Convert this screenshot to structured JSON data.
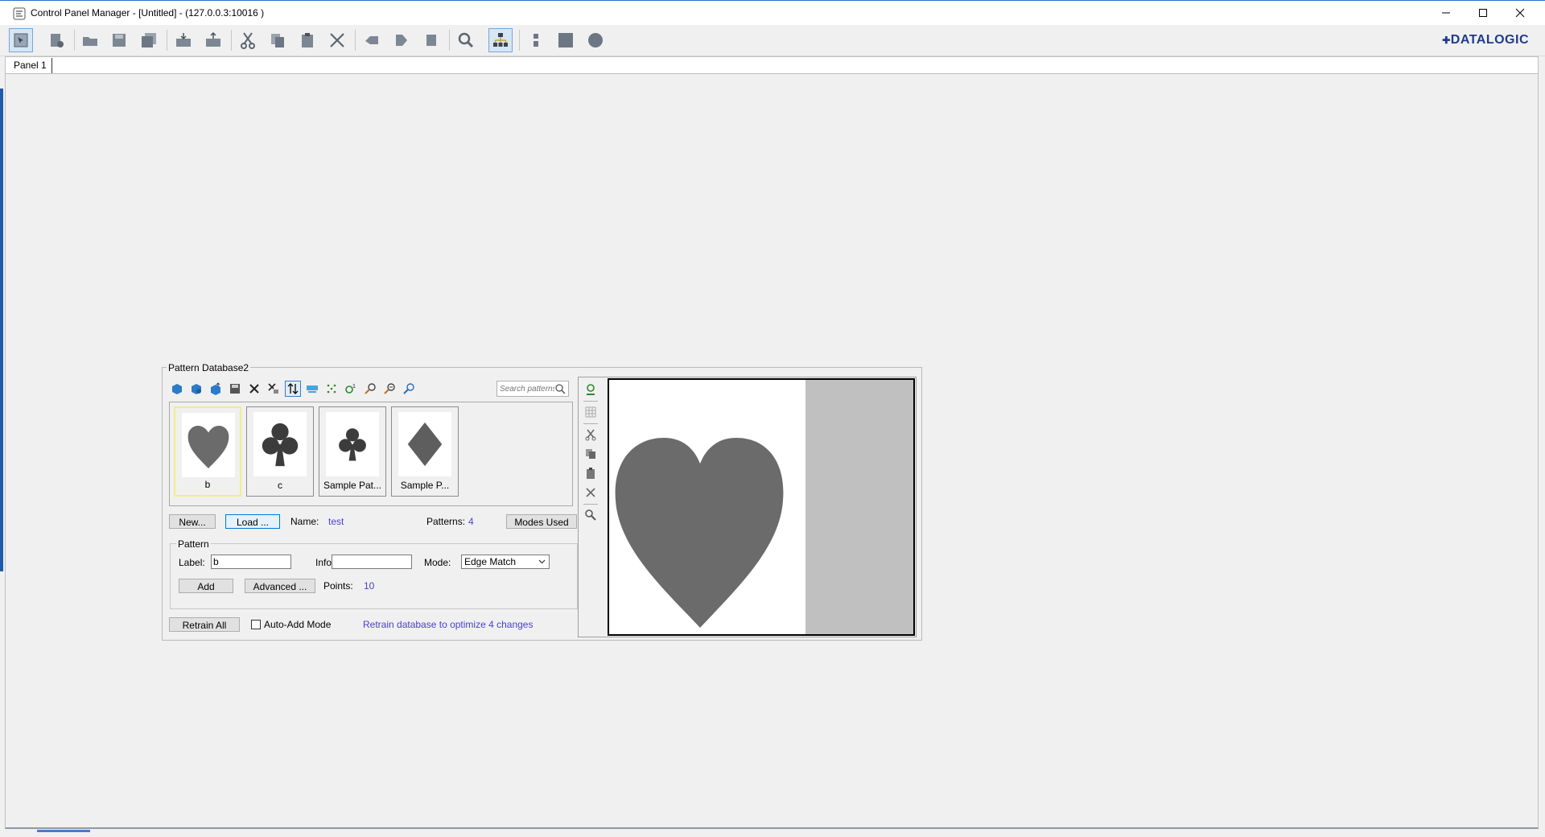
{
  "window": {
    "title": "Control Panel Manager - [Untitled] - (127.0.0.3:10016 )",
    "controls": [
      "minimize-icon",
      "maximize-icon",
      "close-icon"
    ]
  },
  "toolbar": {
    "brand": "DATALOGIC",
    "icons": [
      "select-tool-icon",
      "new-panel-icon",
      "open-folder-icon",
      "save-icon",
      "save-all-icon",
      "import-icon",
      "export-icon",
      "cut-icon",
      "copy-icon",
      "paste-icon",
      "delete-icon",
      "undo-icon",
      "redo-icon",
      "stop-icon",
      "zoom-icon",
      "hierarchy-icon",
      "grip-icon",
      "square-icon",
      "circle-icon"
    ]
  },
  "tabs": [
    {
      "label": "Panel 1"
    }
  ],
  "pattern_db": {
    "title": "Pattern Database2",
    "search_placeholder": "Search patterns",
    "patterns": [
      {
        "label": "b",
        "shape": "heart"
      },
      {
        "label": "c",
        "shape": "club"
      },
      {
        "label": "Sample Pat...",
        "shape": "club"
      },
      {
        "label": "Sample P...",
        "shape": "diamond"
      }
    ],
    "new_label": "New...",
    "load_label": "Load ...",
    "name_label": "Name:",
    "name_value": "test",
    "patterns_label": "Patterns:",
    "patterns_count": "4",
    "modes_used_label": "Modes Used",
    "pattern_group": {
      "title": "Pattern",
      "label_label": "Label:",
      "label_value": "b",
      "info_label": "Info",
      "info_value": "",
      "mode_label": "Mode:",
      "mode_value": "Edge Match",
      "add_label": "Add",
      "advanced_label": "Advanced ...",
      "points_label": "Points:",
      "points_value": "10"
    },
    "retrain_label": "Retrain All",
    "auto_add_label": "Auto-Add Mode",
    "retrain_message": "Retrain database to optimize 4 changes"
  }
}
